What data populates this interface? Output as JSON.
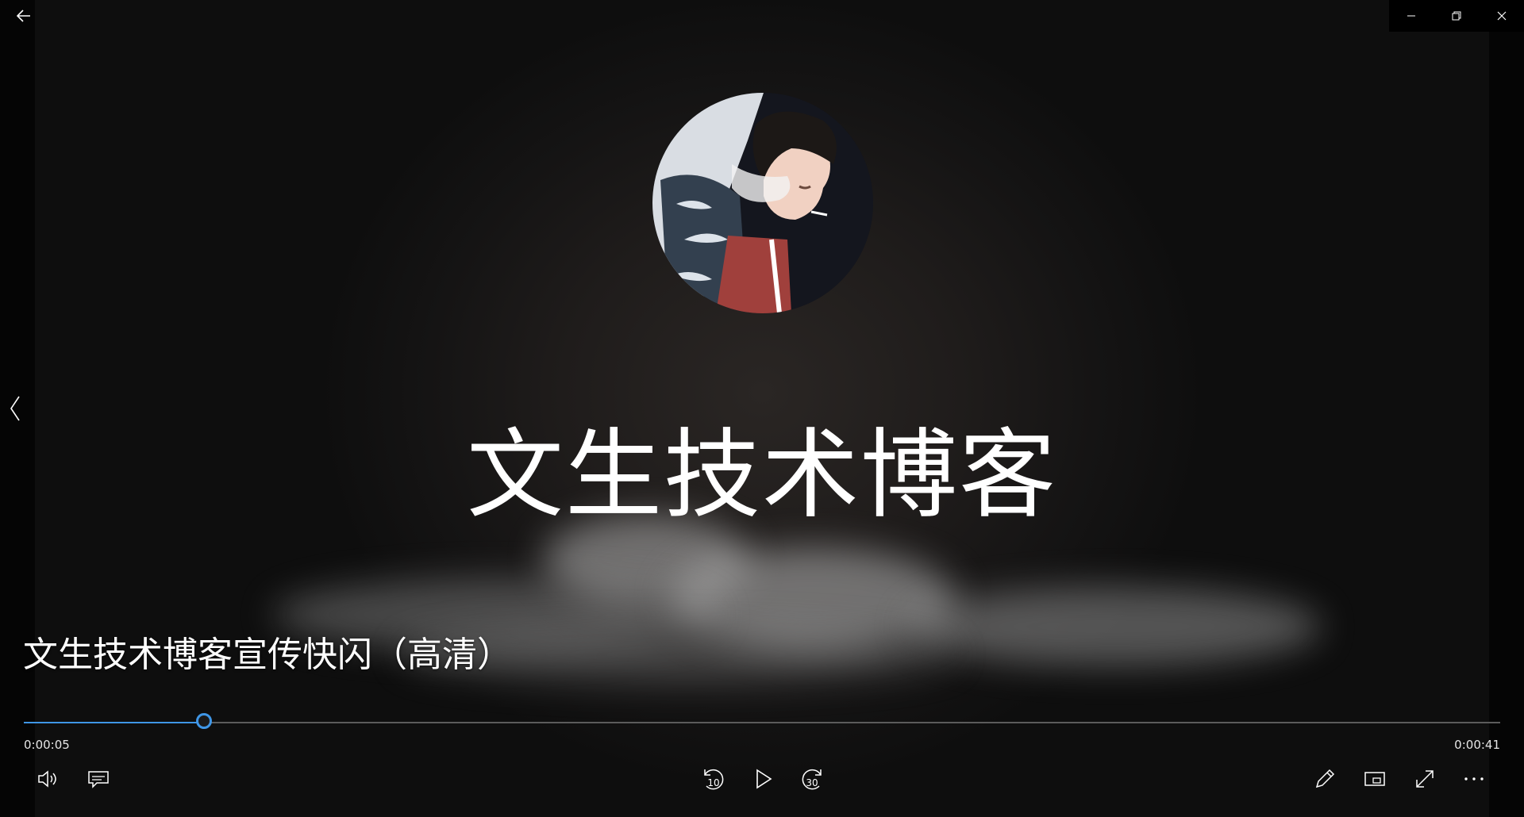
{
  "video": {
    "logo_title": "文生技术博客",
    "caption_title": "文生技术博客宣传快闪（高清）"
  },
  "playback": {
    "current_time": "0:00:05",
    "total_time": "0:00:41",
    "progress_fraction": 0.122
  },
  "icons": {
    "back": "back-arrow-icon",
    "minimize": "minimize-icon",
    "restore": "restore-icon",
    "close": "close-icon",
    "previous": "chevron-left-icon",
    "volume": "volume-icon",
    "subtitles": "subtitles-icon",
    "skip_back": "skip-back-10-icon",
    "play": "play-icon",
    "skip_forward": "skip-forward-30-icon",
    "edit": "pencil-icon",
    "mini_view": "mini-view-icon",
    "fullscreen": "fullscreen-icon",
    "more": "more-icon"
  },
  "labels": {
    "skip_back_seconds": "10",
    "skip_forward_seconds": "30"
  },
  "colors": {
    "accent": "#3f96e6",
    "track": "#5b5b5b"
  }
}
